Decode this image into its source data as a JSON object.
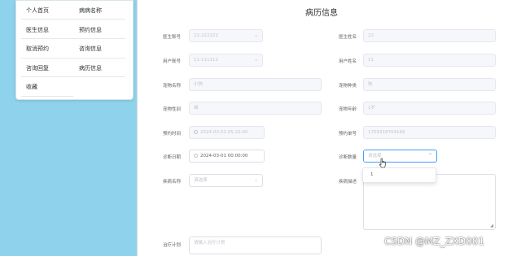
{
  "sidebar": {
    "items": [
      {
        "label": "个人首页"
      },
      {
        "label": "病病名称"
      },
      {
        "label": "医生信息"
      },
      {
        "label": "预约信息"
      },
      {
        "label": "取消预约"
      },
      {
        "label": "咨询信息"
      },
      {
        "label": "咨询回复"
      },
      {
        "label": "病历信息"
      },
      {
        "label": "收藏"
      }
    ]
  },
  "form": {
    "title": "病历信息",
    "fields": {
      "doctor_no": {
        "label": "医生账号",
        "value": "22-222222"
      },
      "doctor_name": {
        "label": "医生姓名",
        "value": "22"
      },
      "user_no": {
        "label": "用户账号",
        "value": "11-111111"
      },
      "user_name": {
        "label": "用户姓名",
        "value": "11"
      },
      "pet_name": {
        "label": "宠物名称",
        "value": "小狗"
      },
      "pet_type": {
        "label": "宠物种类",
        "value": "狗"
      },
      "pet_gender": {
        "label": "宠物性别",
        "value": "雄"
      },
      "pet_age": {
        "label": "宠物年龄",
        "value": "1岁"
      },
      "appt_time": {
        "label": "预约时间",
        "value": "2024-03-01 05:22:00"
      },
      "appt_no": {
        "label": "预约单号",
        "value": "1709318764169"
      },
      "diag_date": {
        "label": "诊断日期",
        "value": "2024-03-01 00:00:00"
      },
      "diag_count": {
        "label": "诊断数量",
        "placeholder": "请选择"
      },
      "disease_name": {
        "label": "疾病名称",
        "placeholder": "请选择"
      },
      "disease_desc": {
        "label": "疾病描述"
      },
      "treatment_plan": {
        "label": "治疗计划",
        "placeholder": "请输入治疗计划"
      }
    },
    "dropdown": {
      "options": [
        "1"
      ]
    }
  },
  "watermark": "CSDN @MZ_ZXD001"
}
